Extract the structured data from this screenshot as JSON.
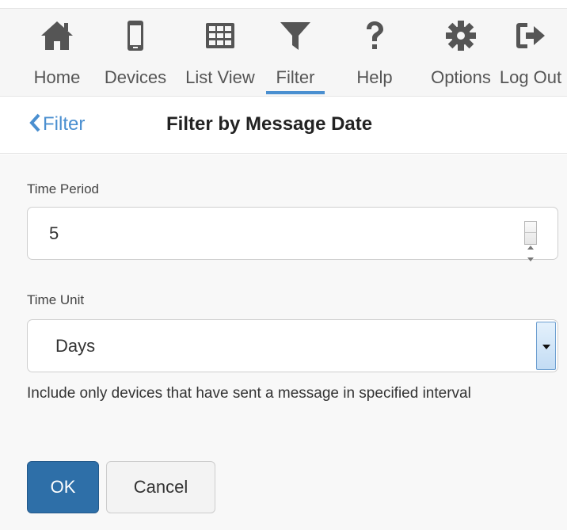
{
  "toolbar": {
    "items": [
      {
        "label": "Home",
        "icon": "home-icon",
        "active": false
      },
      {
        "label": "Devices",
        "icon": "mobile-icon",
        "active": false
      },
      {
        "label": "List View",
        "icon": "table-icon",
        "active": false
      },
      {
        "label": "Filter",
        "icon": "filter-icon",
        "active": true
      },
      {
        "label": "Help",
        "icon": "question-icon",
        "active": false
      },
      {
        "label": "Options",
        "icon": "gear-icon",
        "active": false
      },
      {
        "label": "Log Out",
        "icon": "logout-icon",
        "active": false
      }
    ],
    "icon_color": "#555555",
    "active_color": "#4a8fd0"
  },
  "header": {
    "back_label": "Filter",
    "title": "Filter by Message Date"
  },
  "form": {
    "time_period_label": "Time Period",
    "time_period_value": "5",
    "time_unit_label": "Time Unit",
    "time_unit_value": "Days",
    "helper_text": "Include only devices that have sent a message in specified interval"
  },
  "buttons": {
    "ok_label": "OK",
    "cancel_label": "Cancel",
    "primary_color": "#2e6fa8"
  }
}
